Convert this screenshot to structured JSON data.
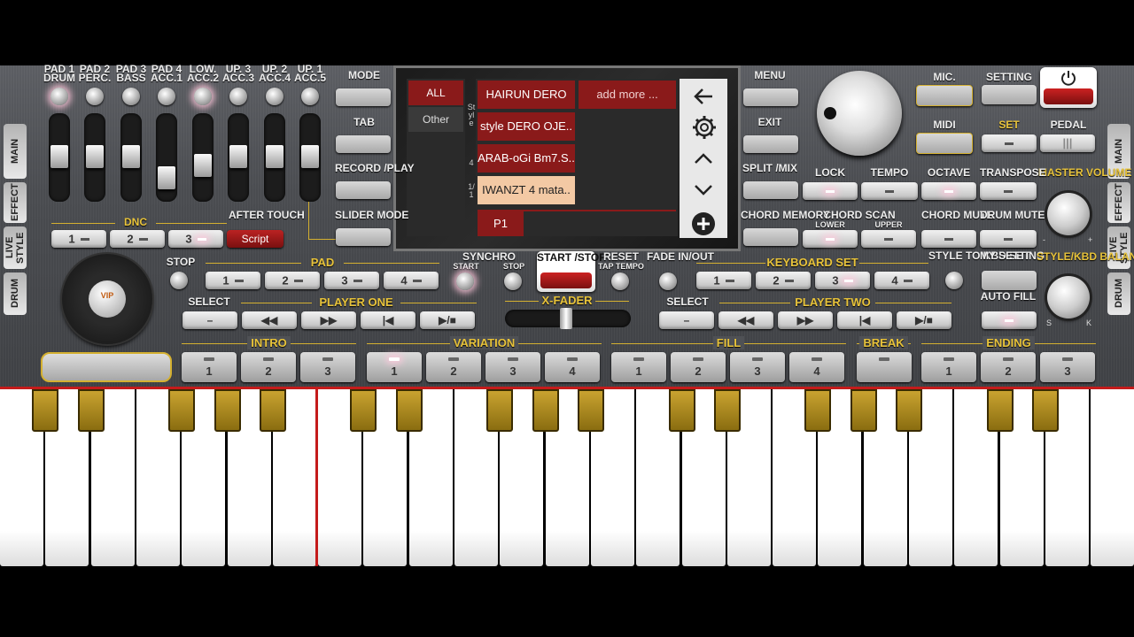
{
  "pads": {
    "labels": [
      [
        "PAD 1",
        "DRUM"
      ],
      [
        "PAD 2",
        "PERC."
      ],
      [
        "PAD 3",
        "BASS"
      ],
      [
        "PAD 4",
        "ACC.1"
      ],
      [
        "LOW.",
        "ACC.2"
      ],
      [
        "UP. 3",
        "ACC.3"
      ],
      [
        "UP. 2",
        "ACC.4"
      ],
      [
        "UP. 1",
        "ACC.5"
      ]
    ]
  },
  "side_tabs_left": [
    "MAIN",
    "EFFECT",
    "LIVE STYLE",
    "DRUM"
  ],
  "side_tabs_right": [
    "MAIN",
    "EFFECT",
    "LIVE STYLE",
    "DRUM"
  ],
  "dnc": {
    "title": "DNC",
    "buttons": [
      "1",
      "2",
      "3"
    ],
    "after_touch": "AFTER TOUCH",
    "script": "Script"
  },
  "left_menu": [
    "MODE",
    "TAB",
    "RECORD /PLAY",
    "SLIDER MODE"
  ],
  "right_menu": [
    "MENU",
    "EXIT",
    "SPLIT /MIX",
    "CHORD MEMORY"
  ],
  "screen": {
    "filters": [
      "ALL",
      "Other"
    ],
    "style_letters": "Style",
    "count": "4",
    "page": "1/1",
    "styles": [
      "HAIRUN DERO",
      "style DERO OJE..",
      "ARAB-oGi Bm7.S..",
      "IWANZT 4 mata.."
    ],
    "add_more": "add more ...",
    "preset": "P1"
  },
  "top_right": {
    "mic": "MIC.",
    "setting": "SETTING",
    "midi": "MIDI",
    "set": "SET",
    "pedal": "PEDAL"
  },
  "row_lock": [
    "LOCK",
    "TEMPO",
    "OCTAVE",
    "TRANSPOSE"
  ],
  "master_volume": "MASTER VOLUME",
  "row_chord": {
    "chord_scan": "CHORD SCAN",
    "lower": "LOWER",
    "upper": "UPPER",
    "chord_mute": "CHORD MUTE",
    "drum_mute": "DRUM MUTE"
  },
  "pad_row": {
    "stop": "STOP",
    "pad": "PAD",
    "buttons": [
      "1",
      "2",
      "3",
      "4"
    ]
  },
  "synchro": {
    "title": "SYNCHRO",
    "start": "START",
    "stop": "STOP"
  },
  "start_stop": "START /STOP",
  "reset": {
    "title": "RESET",
    "sub": "TAP TEMPO"
  },
  "fade": "FADE IN/OUT",
  "keyboard_set": {
    "title": "KEYBOARD SET",
    "buttons": [
      "1",
      "2",
      "3",
      "4"
    ]
  },
  "style_to_kbd": "STYLE TO KBD SET",
  "my_setting": "MY SETTING",
  "auto_fill": "AUTO FILL",
  "style_kbd_balance": {
    "title": "STYLE/KBD BALANCE",
    "s": "S",
    "k": "K"
  },
  "player_one": {
    "select": "SELECT",
    "title": "PLAYER ONE"
  },
  "player_two": {
    "select": "SELECT",
    "title": "PLAYER TWO"
  },
  "xfader": "X-FADER",
  "sections": {
    "intro": {
      "title": "INTRO",
      "buttons": [
        "1",
        "2",
        "3"
      ]
    },
    "variation": {
      "title": "VARIATION",
      "buttons": [
        "1",
        "2",
        "3",
        "4"
      ]
    },
    "fill": {
      "title": "FILL",
      "buttons": [
        "1",
        "2",
        "3",
        "4"
      ]
    },
    "break": {
      "title": "BREAK"
    },
    "ending": {
      "title": "ENDING",
      "buttons": [
        "1",
        "2",
        "3"
      ]
    }
  },
  "volume_marks": {
    "minus": "-",
    "plus": "+"
  },
  "vip": "VIP"
}
